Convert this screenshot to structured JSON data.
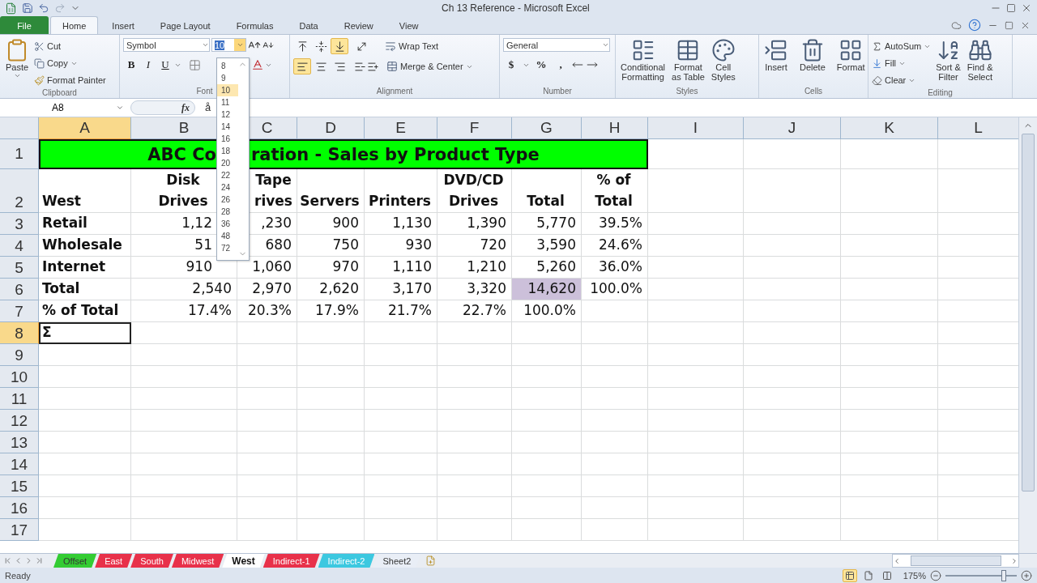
{
  "title_bar": {
    "title": "Ch 13 Reference - Microsoft Excel"
  },
  "ribbon_tabs": [
    {
      "label": "File",
      "kind": "file",
      "selected": false
    },
    {
      "label": "Home",
      "kind": "tab",
      "selected": true
    },
    {
      "label": "Insert",
      "kind": "tab",
      "selected": false
    },
    {
      "label": "Page Layout",
      "kind": "tab",
      "selected": false
    },
    {
      "label": "Formulas",
      "kind": "tab",
      "selected": false
    },
    {
      "label": "Data",
      "kind": "tab",
      "selected": false
    },
    {
      "label": "Review",
      "kind": "tab",
      "selected": false
    },
    {
      "label": "View",
      "kind": "tab",
      "selected": false
    }
  ],
  "clipboard": {
    "paste": "Paste",
    "cut": "Cut",
    "copy": "Copy",
    "format_painter": "Format Painter",
    "label": "Clipboard"
  },
  "font": {
    "font_name": "Symbol",
    "font_size": "10",
    "bold": "B",
    "italic": "I",
    "underline": "U",
    "label": "Font"
  },
  "alignment": {
    "buttons": [
      {
        "kind": "top",
        "selected": false
      },
      {
        "kind": "middle",
        "selected": false
      },
      {
        "kind": "bottom",
        "selected": true
      },
      {
        "kind": "left",
        "selected": true
      },
      {
        "kind": "center",
        "selected": false
      },
      {
        "kind": "right",
        "selected": false
      }
    ],
    "wrap_text": "Wrap Text",
    "merge_center": "Merge & Center",
    "label": "Alignment"
  },
  "number": {
    "format": "General",
    "currency": "$",
    "percent": "%",
    "comma": ",",
    "label": "Number"
  },
  "styles": {
    "buttons": [
      {
        "lines": [
          "Conditional",
          "Formatting"
        ]
      },
      {
        "lines": [
          "Format",
          "as Table"
        ]
      },
      {
        "lines": [
          "Cell",
          "Styles"
        ]
      }
    ],
    "label": "Styles"
  },
  "cells": {
    "buttons": [
      {
        "lines": [
          "Insert"
        ]
      },
      {
        "lines": [
          "Delete"
        ]
      },
      {
        "lines": [
          "Format"
        ]
      }
    ],
    "label": "Cells"
  },
  "editing": {
    "autosum": "AutoSum",
    "fill": "Fill",
    "clear": "Clear",
    "buttons": [
      {
        "lines": [
          "Sort &",
          "Filter"
        ]
      },
      {
        "lines": [
          "Find &",
          "Select"
        ]
      }
    ],
    "label": "Editing"
  },
  "formula_bar": {
    "name_box": "A8",
    "fx": "fx",
    "content": "å"
  },
  "font_size_menu": {
    "options": [
      {
        "label": "8",
        "selected": false
      },
      {
        "label": "9",
        "selected": false
      },
      {
        "label": "10",
        "selected": true
      },
      {
        "label": "11",
        "selected": false
      },
      {
        "label": "12",
        "selected": false
      },
      {
        "label": "14",
        "selected": false
      },
      {
        "label": "16",
        "selected": false
      },
      {
        "label": "18",
        "selected": false
      },
      {
        "label": "20",
        "selected": false
      },
      {
        "label": "22",
        "selected": false
      },
      {
        "label": "24",
        "selected": false
      },
      {
        "label": "26",
        "selected": false
      },
      {
        "label": "28",
        "selected": false
      },
      {
        "label": "36",
        "selected": false
      },
      {
        "label": "48",
        "selected": false
      },
      {
        "label": "72",
        "selected": false
      }
    ]
  },
  "sheet": {
    "columns": [
      {
        "label": "A",
        "selected": true
      },
      {
        "label": "B",
        "selected": false
      },
      {
        "label": "C",
        "selected": false
      },
      {
        "label": "D",
        "selected": false
      },
      {
        "label": "E",
        "selected": false
      },
      {
        "label": "F",
        "selected": false
      },
      {
        "label": "G",
        "selected": false
      },
      {
        "label": "H",
        "selected": false
      },
      {
        "label": "I",
        "selected": false
      },
      {
        "label": "J",
        "selected": false
      },
      {
        "label": "K",
        "selected": false
      },
      {
        "label": "L",
        "selected": false
      }
    ],
    "rows": [
      {
        "header": "1",
        "kind": "title",
        "selected": false,
        "title_left": "ABC Co",
        "title_right": "ration - Sales by Product Type"
      },
      {
        "header": "2",
        "kind": "header",
        "selected": false,
        "cells": [
          [
            "West"
          ],
          [
            "Disk",
            "Drives"
          ],
          [
            "Tape",
            "rives"
          ],
          [
            "Servers"
          ],
          [
            "Printers"
          ],
          [
            "DVD/CD",
            "Drives"
          ],
          [
            "Total"
          ],
          [
            "% of",
            "Total"
          ]
        ]
      },
      {
        "header": "3",
        "kind": "data",
        "selected": false,
        "cells": [
          "Retail",
          "1,12",
          ",230",
          "900",
          "1,130",
          "1,390",
          "5,770",
          "39.5%"
        ]
      },
      {
        "header": "4",
        "kind": "data",
        "selected": false,
        "cells": [
          "Wholesale",
          "51",
          "680",
          "750",
          "930",
          "720",
          "3,590",
          "24.6%"
        ]
      },
      {
        "header": "5",
        "kind": "data",
        "selected": false,
        "cells": [
          "Internet",
          "910",
          "1,060",
          "970",
          "1,110",
          "1,210",
          "5,260",
          "36.0%"
        ]
      },
      {
        "header": "6",
        "kind": "data",
        "selected": false,
        "cells": [
          "Total",
          "2,540",
          "2,970",
          "2,620",
          "3,170",
          "3,320",
          {
            "text": "14,620",
            "color": "#ccc0da"
          },
          "100.0%"
        ]
      },
      {
        "header": "7",
        "kind": "data",
        "selected": false,
        "cells": [
          "% of Total",
          "17.4%",
          "20.3%",
          "17.9%",
          "21.7%",
          "22.7%",
          "100.0%",
          null
        ]
      },
      {
        "header": "8",
        "kind": "data",
        "selected": true,
        "cells": [
          {
            "text": "Σ",
            "active": true
          },
          null,
          null,
          null,
          null,
          null,
          null,
          null
        ]
      },
      {
        "header": "9",
        "kind": "empty",
        "selected": false
      },
      {
        "header": "10",
        "kind": "empty",
        "selected": false
      },
      {
        "header": "11",
        "kind": "empty",
        "selected": false
      },
      {
        "header": "12",
        "kind": "empty",
        "selected": false
      },
      {
        "header": "13",
        "kind": "empty",
        "selected": false
      },
      {
        "header": "14",
        "kind": "empty",
        "selected": false
      },
      {
        "header": "15",
        "kind": "empty",
        "selected": false
      },
      {
        "header": "16",
        "kind": "empty",
        "selected": false
      },
      {
        "header": "17",
        "kind": "empty",
        "selected": false
      }
    ]
  },
  "sheet_tabs": [
    {
      "label": "Offset",
      "color": "#33cc33",
      "selected": false
    },
    {
      "label": "East",
      "color": "#e8314a",
      "selected": false
    },
    {
      "label": "South",
      "color": "#e8314a",
      "selected": false
    },
    {
      "label": "Midwest",
      "color": "#e8314a",
      "selected": false
    },
    {
      "label": "West",
      "color": "#ffffff",
      "selected": true
    },
    {
      "label": "Indirect-1",
      "color": "#e8314a",
      "selected": false
    },
    {
      "label": "Indirect-2",
      "color": "#3cc8e0",
      "selected": false
    },
    {
      "label": "Sheet2",
      "color": "#e9eef6",
      "selected": false
    }
  ],
  "status_bar": {
    "status": "Ready",
    "views": [
      {
        "kind": "normal",
        "selected": true
      },
      {
        "kind": "page_layout",
        "selected": false
      },
      {
        "kind": "page_break",
        "selected": false
      }
    ],
    "zoom": "175%",
    "zoom_slider": {
      "level": 0.82
    }
  }
}
